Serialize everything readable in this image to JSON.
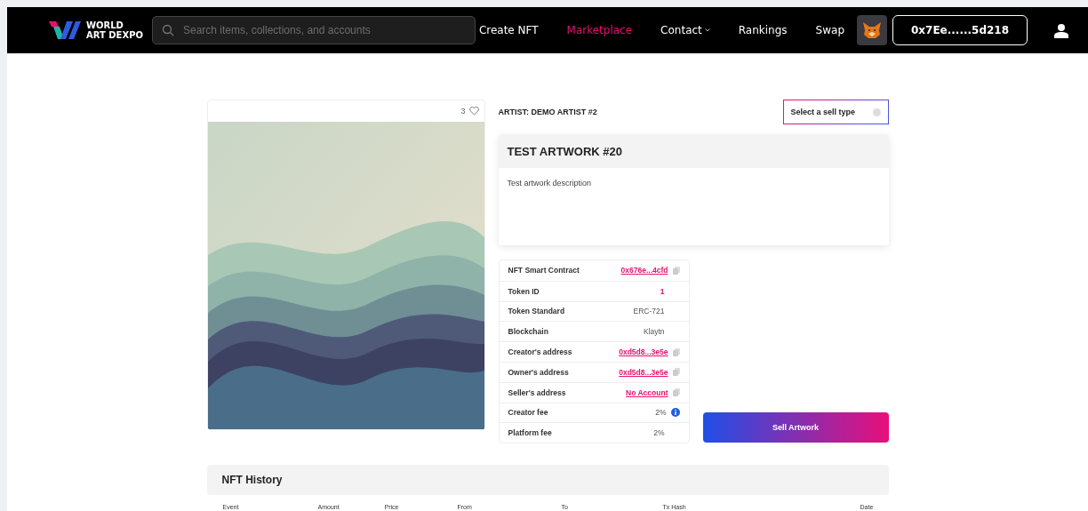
{
  "brand": {
    "line1": "WORLD",
    "line2": "ART DEXPO"
  },
  "search": {
    "placeholder": "Search items, collections, and accounts"
  },
  "nav": [
    {
      "label": "Create NFT",
      "selected": false,
      "dropdown": false
    },
    {
      "label": "Marketplace",
      "selected": true,
      "dropdown": false
    },
    {
      "label": "Contact",
      "selected": false,
      "dropdown": true
    },
    {
      "label": "Rankings",
      "selected": false,
      "dropdown": false
    },
    {
      "label": "Swap",
      "selected": false,
      "dropdown": false
    }
  ],
  "wallet": {
    "address": "0x7Ee......5d218"
  },
  "artwork": {
    "likes": "3"
  },
  "artist": "ARTIST: DEMO ARTIST #2",
  "sell_type": {
    "placeholder": "Select a sell type"
  },
  "title": "TEST ARTWORK #20",
  "description": "Test artwork description",
  "details": [
    {
      "label": "NFT Smart Contract",
      "value": "0x676e...4cfd",
      "kind": "link"
    },
    {
      "label": "Token ID",
      "value": "1",
      "kind": "accent"
    },
    {
      "label": "Token Standard",
      "value": "ERC-721",
      "kind": "text"
    },
    {
      "label": "Blockchain",
      "value": "Klaytn",
      "kind": "text"
    },
    {
      "label": "Creator's address",
      "value": "0xd5d8...3e5e",
      "kind": "link"
    },
    {
      "label": "Owner's address",
      "value": "0xd5d8...3e5e",
      "kind": "link"
    },
    {
      "label": "Seller's address",
      "value": "No Account",
      "kind": "link"
    },
    {
      "label": "Creator fee",
      "value": "2%",
      "kind": "info"
    },
    {
      "label": "Platform fee",
      "value": "2%",
      "kind": "text"
    }
  ],
  "sell_button": "Sell Artwork",
  "history": {
    "title": "NFT History",
    "columns": [
      "Event",
      "Amount",
      "Price",
      "From",
      "To",
      "Tx Hash",
      "Date"
    ]
  }
}
